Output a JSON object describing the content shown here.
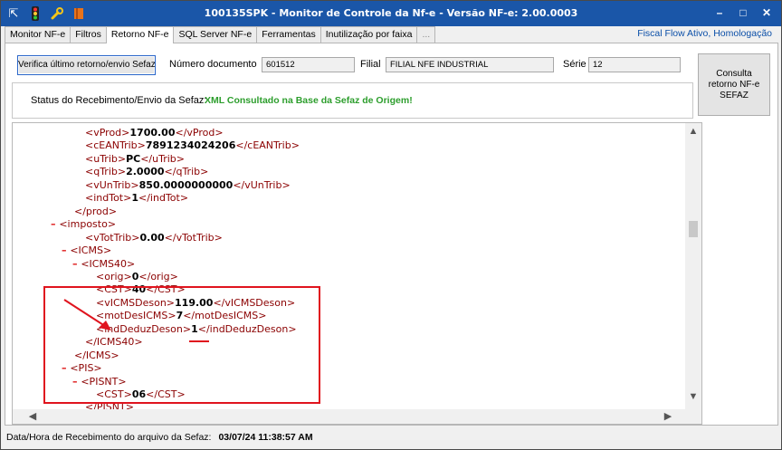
{
  "window": {
    "title": "100135SPK - Monitor de Controle da Nf-e - Versão NF-e: 2.00.0003",
    "toolbar_icons": [
      "export-icon",
      "traffic-light-icon",
      "wrench-icon",
      "book-icon"
    ],
    "controls": {
      "minimize": "–",
      "maximize": "□",
      "close": "✕"
    }
  },
  "tabs": [
    {
      "label": "Monitor NF-e",
      "active": false
    },
    {
      "label": "Filtros",
      "active": false
    },
    {
      "label": "Retorno NF-e",
      "active": true
    },
    {
      "label": "SQL Server NF-e",
      "active": false
    },
    {
      "label": "Ferramentas",
      "active": false
    },
    {
      "label": "Inutilização por faixa",
      "active": false
    },
    {
      "label": "...",
      "active": false
    }
  ],
  "status_link": "Fiscal Flow Ativo, Homologação",
  "verifica_button": "Verifica último retorno/envio Sefaz",
  "consulta_button": "Consulta retorno NF-e SEFAZ",
  "fields": {
    "numero_label": "Número documento",
    "numero_value": "601512",
    "filial_label": "Filial",
    "filial_value": "FILIAL NFE INDUSTRIAL",
    "serie_label": "Série",
    "serie_value": "12"
  },
  "status": {
    "label": "Status do Recebimento/Envio da Sefaz:",
    "value": "XML Consultado na Base da Sefaz de Origem!"
  },
  "xml_lines": [
    {
      "indent": 2,
      "minus": false,
      "open": "vProd",
      "value": "1700.00",
      "close": "vProd"
    },
    {
      "indent": 2,
      "minus": false,
      "open": "cEANTrib",
      "value": "7891234024206",
      "close": "cEANTrib"
    },
    {
      "indent": 2,
      "minus": false,
      "open": "uTrib",
      "value": "PC",
      "close": "uTrib"
    },
    {
      "indent": 2,
      "minus": false,
      "open": "qTrib",
      "value": "2.0000",
      "close": "qTrib"
    },
    {
      "indent": 2,
      "minus": false,
      "open": "vUnTrib",
      "value": "850.0000000000",
      "close": "vUnTrib"
    },
    {
      "indent": 2,
      "minus": false,
      "open": "indTot",
      "value": "1",
      "close": "indTot"
    },
    {
      "indent": 1,
      "minus": false,
      "open": "",
      "value": "",
      "close": "prod"
    },
    {
      "indent": 0,
      "minus": true,
      "open": "imposto",
      "value": "",
      "close": ""
    },
    {
      "indent": 2,
      "minus": false,
      "open": "vTotTrib",
      "value": "0.00",
      "close": "vTotTrib"
    },
    {
      "indent": 1,
      "minus": true,
      "open": "ICMS",
      "value": "",
      "close": ""
    },
    {
      "indent": 2,
      "minus": true,
      "open": "ICMS40",
      "value": "",
      "close": ""
    },
    {
      "indent": 3,
      "minus": false,
      "open": "orig",
      "value": "0",
      "close": "orig"
    },
    {
      "indent": 3,
      "minus": false,
      "open": "CST",
      "value": "40",
      "close": "CST"
    },
    {
      "indent": 3,
      "minus": false,
      "open": "vICMSDeson",
      "value": "119.00",
      "close": "vICMSDeson"
    },
    {
      "indent": 3,
      "minus": false,
      "open": "motDesICMS",
      "value": "7",
      "close": "motDesICMS"
    },
    {
      "indent": 3,
      "minus": false,
      "open": "indDeduzDeson",
      "value": "1",
      "close": "indDeduzDeson"
    },
    {
      "indent": 2,
      "minus": false,
      "open": "",
      "value": "",
      "close": "ICMS40"
    },
    {
      "indent": 1,
      "minus": false,
      "open": "",
      "value": "",
      "close": "ICMS"
    },
    {
      "indent": 1,
      "minus": true,
      "open": "PIS",
      "value": "",
      "close": ""
    },
    {
      "indent": 2,
      "minus": true,
      "open": "PISNT",
      "value": "",
      "close": ""
    },
    {
      "indent": 3,
      "minus": false,
      "open": "CST",
      "value": "06",
      "close": "CST"
    },
    {
      "indent": 2,
      "minus": false,
      "open": "",
      "value": "",
      "close": "PISNT"
    }
  ],
  "footer": {
    "label": "Data/Hora de Recebimento do arquivo da Sefaz:",
    "value": "03/07/24 11:38:57 AM"
  },
  "colors": {
    "titlebar": "#1a56a8",
    "highlight": "#e0141e",
    "status_ok": "#2d9e2d",
    "xml_tag": "#8b0000"
  }
}
